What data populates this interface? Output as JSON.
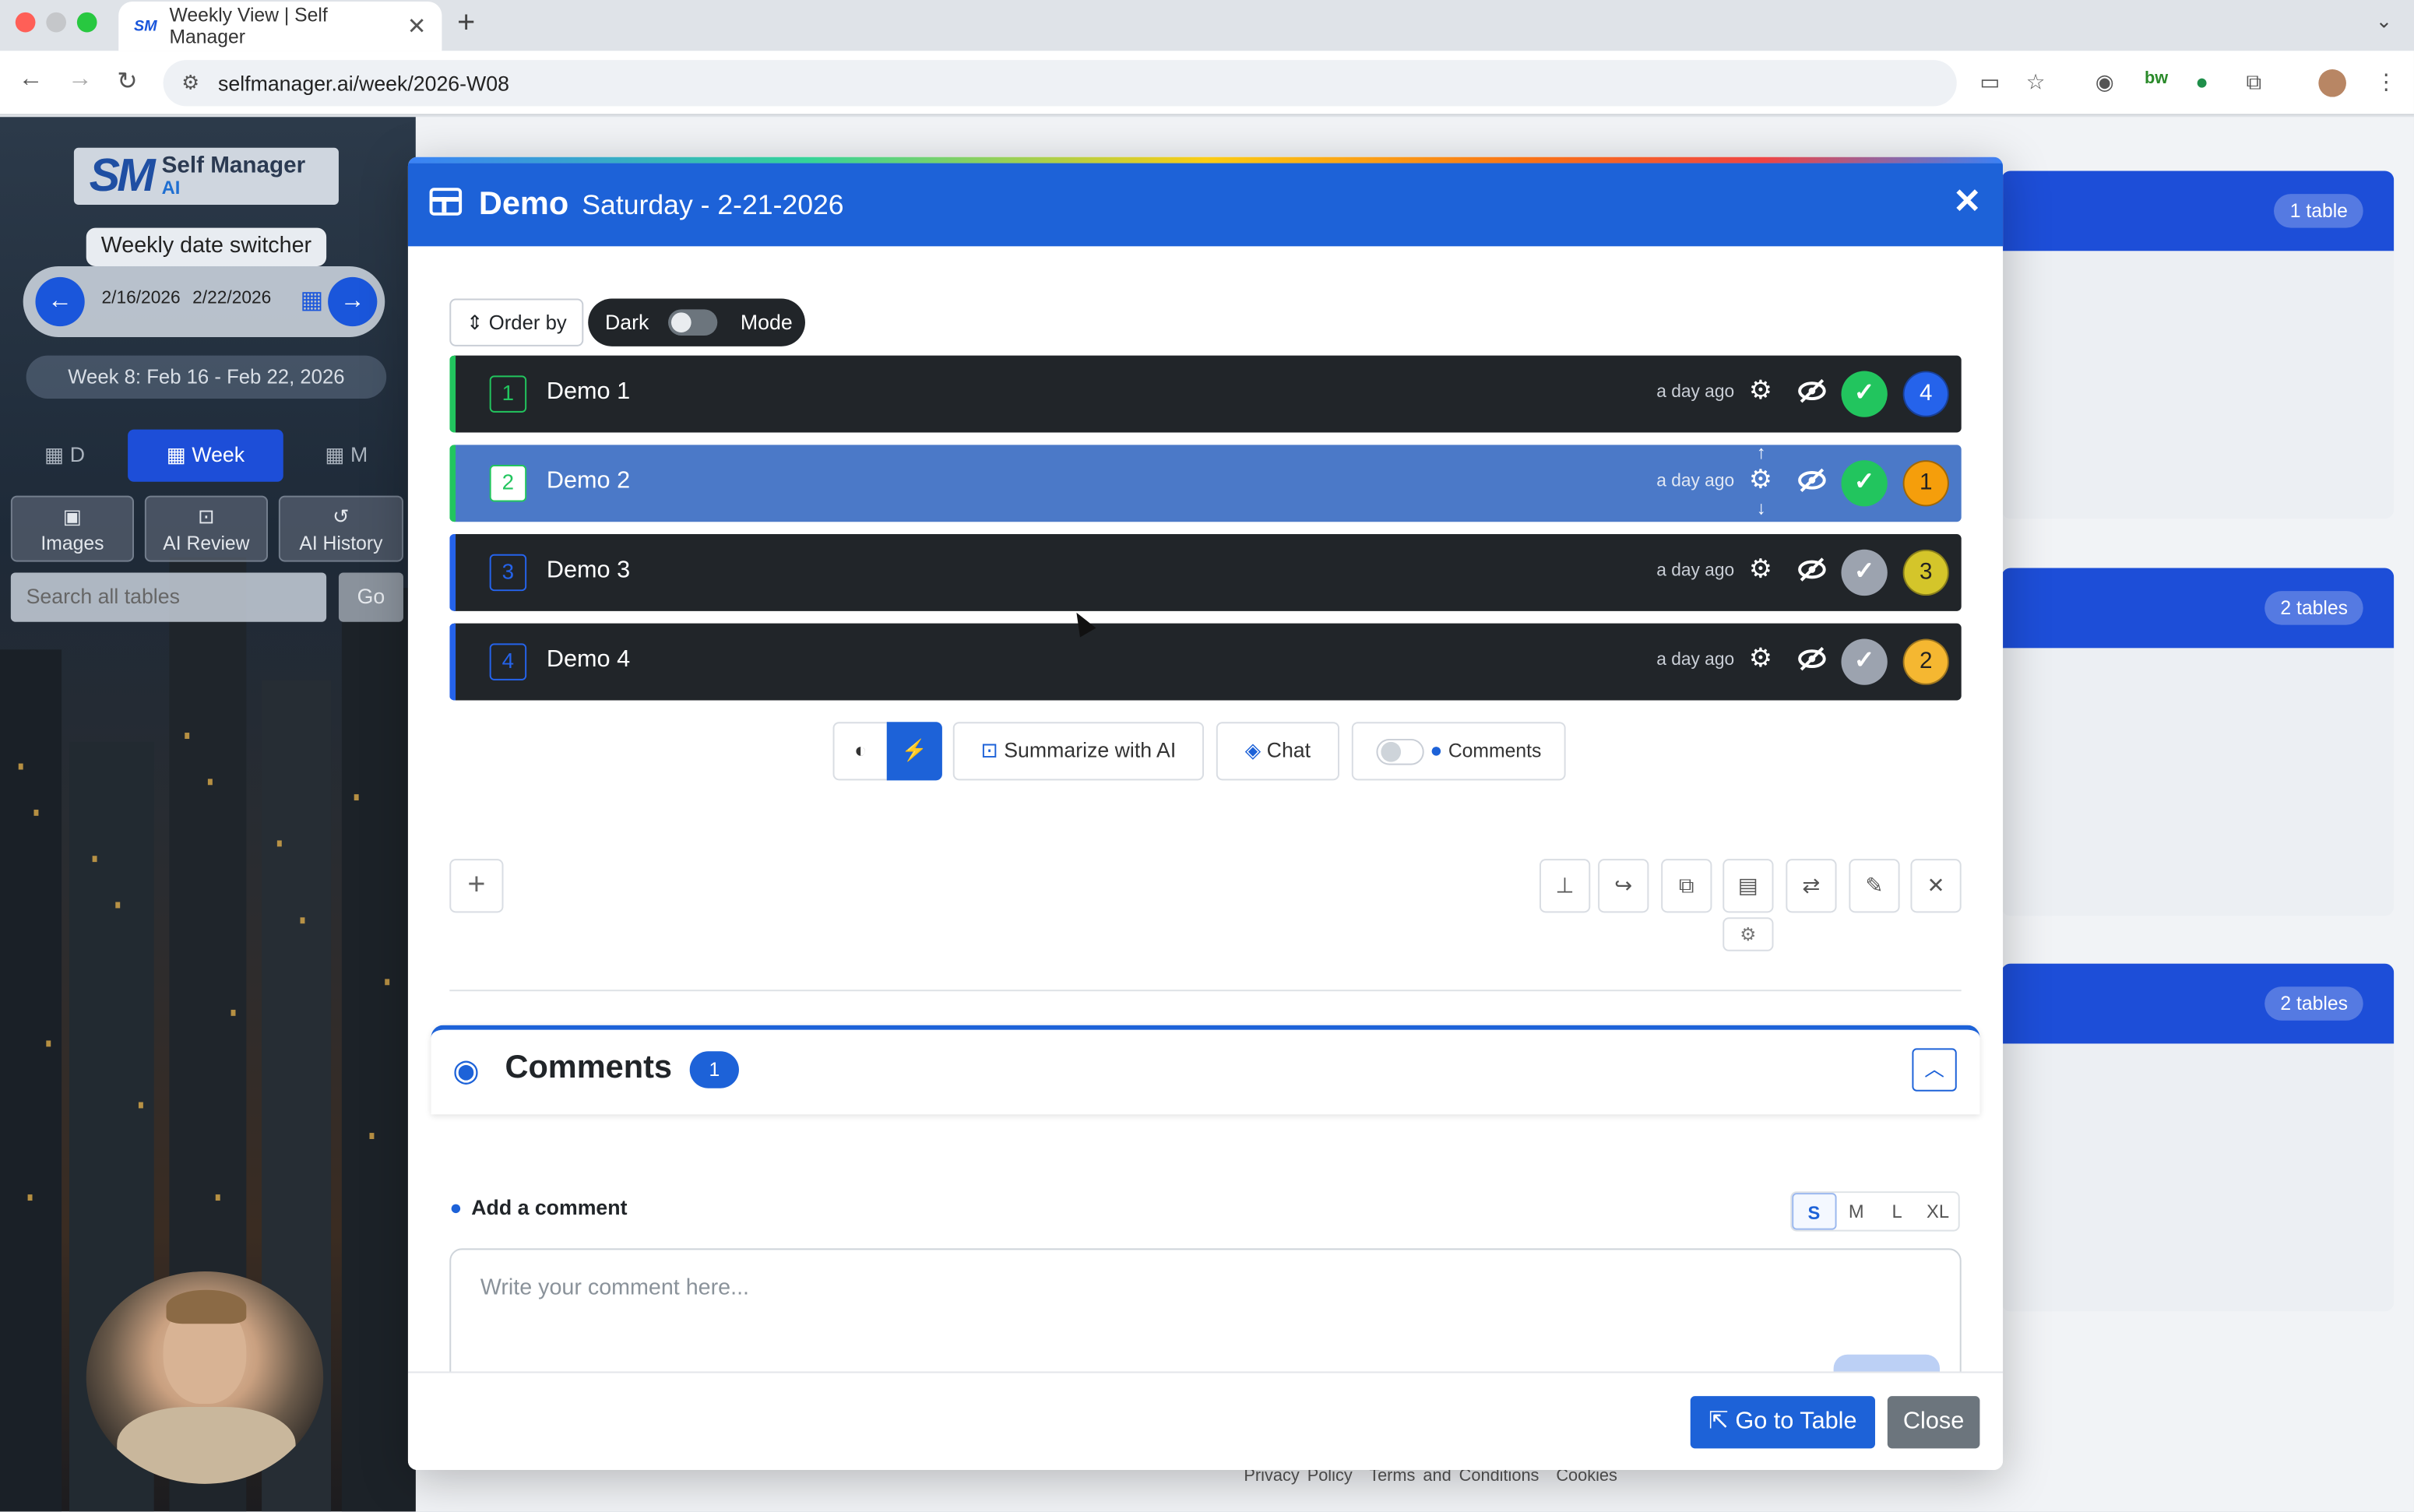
{
  "browser": {
    "tab_title": "Weekly View | Self Manager",
    "tab_favicon": "SM",
    "url": "selfmanager.ai/week/2026-W08"
  },
  "sidebar": {
    "logo_main": "Self Manager",
    "logo_sub": "AI",
    "date_switcher_label": "Weekly date switcher",
    "start_date": "2/16/2026",
    "end_date": "2/22/2026",
    "week_label": "Week 8: Feb 16 - Feb 22, 2026",
    "view_tabs": [
      {
        "label": "D"
      },
      {
        "label": "Week"
      },
      {
        "label": "M"
      }
    ],
    "tools": [
      {
        "label": "Images",
        "icon": "image-icon"
      },
      {
        "label": "AI Review",
        "icon": "robot-icon"
      },
      {
        "label": "AI History",
        "icon": "history-icon"
      }
    ],
    "search_placeholder": "Search all tables",
    "search_button": "Go"
  },
  "background_cards": [
    {
      "count_label": "1 table"
    },
    {
      "count_label": "2 tables"
    },
    {
      "count_label": "2 tables"
    }
  ],
  "footer_links": [
    "Privacy Policy",
    "Terms and Conditions",
    "Cookies"
  ],
  "modal": {
    "title": "Demo",
    "date": "Saturday - 2-21-2026",
    "order_by_label": "Order by",
    "dark_label": "Dark",
    "mode_label": "Mode",
    "rows": [
      {
        "num": "1",
        "label": "Demo 1",
        "ago": "a day ago",
        "done": true,
        "badge": "4",
        "badge_color": "#2563eb",
        "accent": "#22c55e"
      },
      {
        "num": "2",
        "label": "Demo 2",
        "ago": "a day ago",
        "done": true,
        "badge": "1",
        "badge_color": "#f59e0b",
        "accent": "#22c55e"
      },
      {
        "num": "3",
        "label": "Demo 3",
        "ago": "a day ago",
        "done": false,
        "badge": "3",
        "badge_color": "#d4c52a",
        "accent": "#2563eb"
      },
      {
        "num": "4",
        "label": "Demo 4",
        "ago": "a day ago",
        "done": false,
        "badge": "2",
        "badge_color": "#f5b731",
        "accent": "#2563eb"
      }
    ],
    "actions": {
      "summarize": "Summarize with AI",
      "chat": "Chat",
      "comments_toggle": "Comments"
    },
    "comments": {
      "title": "Comments",
      "count": "1",
      "add_label": "Add a comment",
      "sizes": [
        "S",
        "M",
        "L",
        "XL"
      ],
      "placeholder": "Write your comment here..."
    },
    "go_to_table": "Go to Table",
    "close": "Close"
  },
  "colors": {
    "primary": "#1d62d8",
    "row_dark": "#212529",
    "row_selected": "#4b79c8",
    "check_done": "#22c55e",
    "check_pending": "#9ca3af"
  }
}
